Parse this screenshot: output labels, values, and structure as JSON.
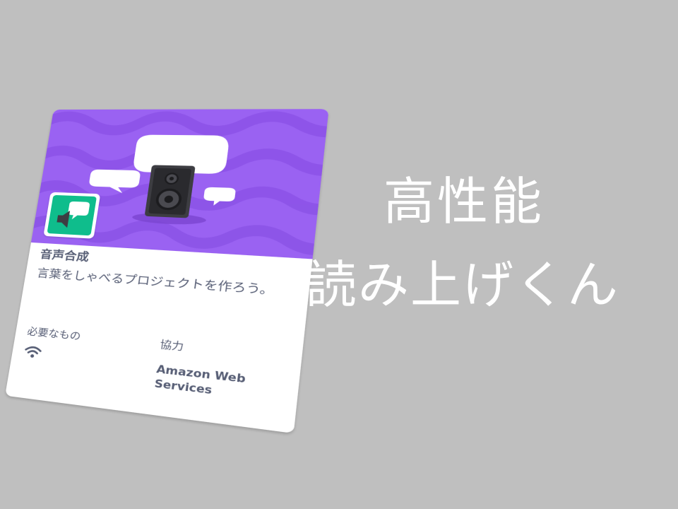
{
  "card": {
    "title": "音声合成",
    "description": "言葉をしゃべるプロジェクトを作ろう。",
    "requirements_label": "必要なもの",
    "requirements_icon": "wifi-icon",
    "collaborator_label": "協力",
    "collaborator_line1": "Amazon Web",
    "collaborator_line2": "Services",
    "banner_color": "#9a62f2",
    "icon_color": "#0fbd8c",
    "icon": "speech-bubble-speaker-icon"
  },
  "headline": {
    "line1": "高性能",
    "line2": "読み上げくん"
  }
}
